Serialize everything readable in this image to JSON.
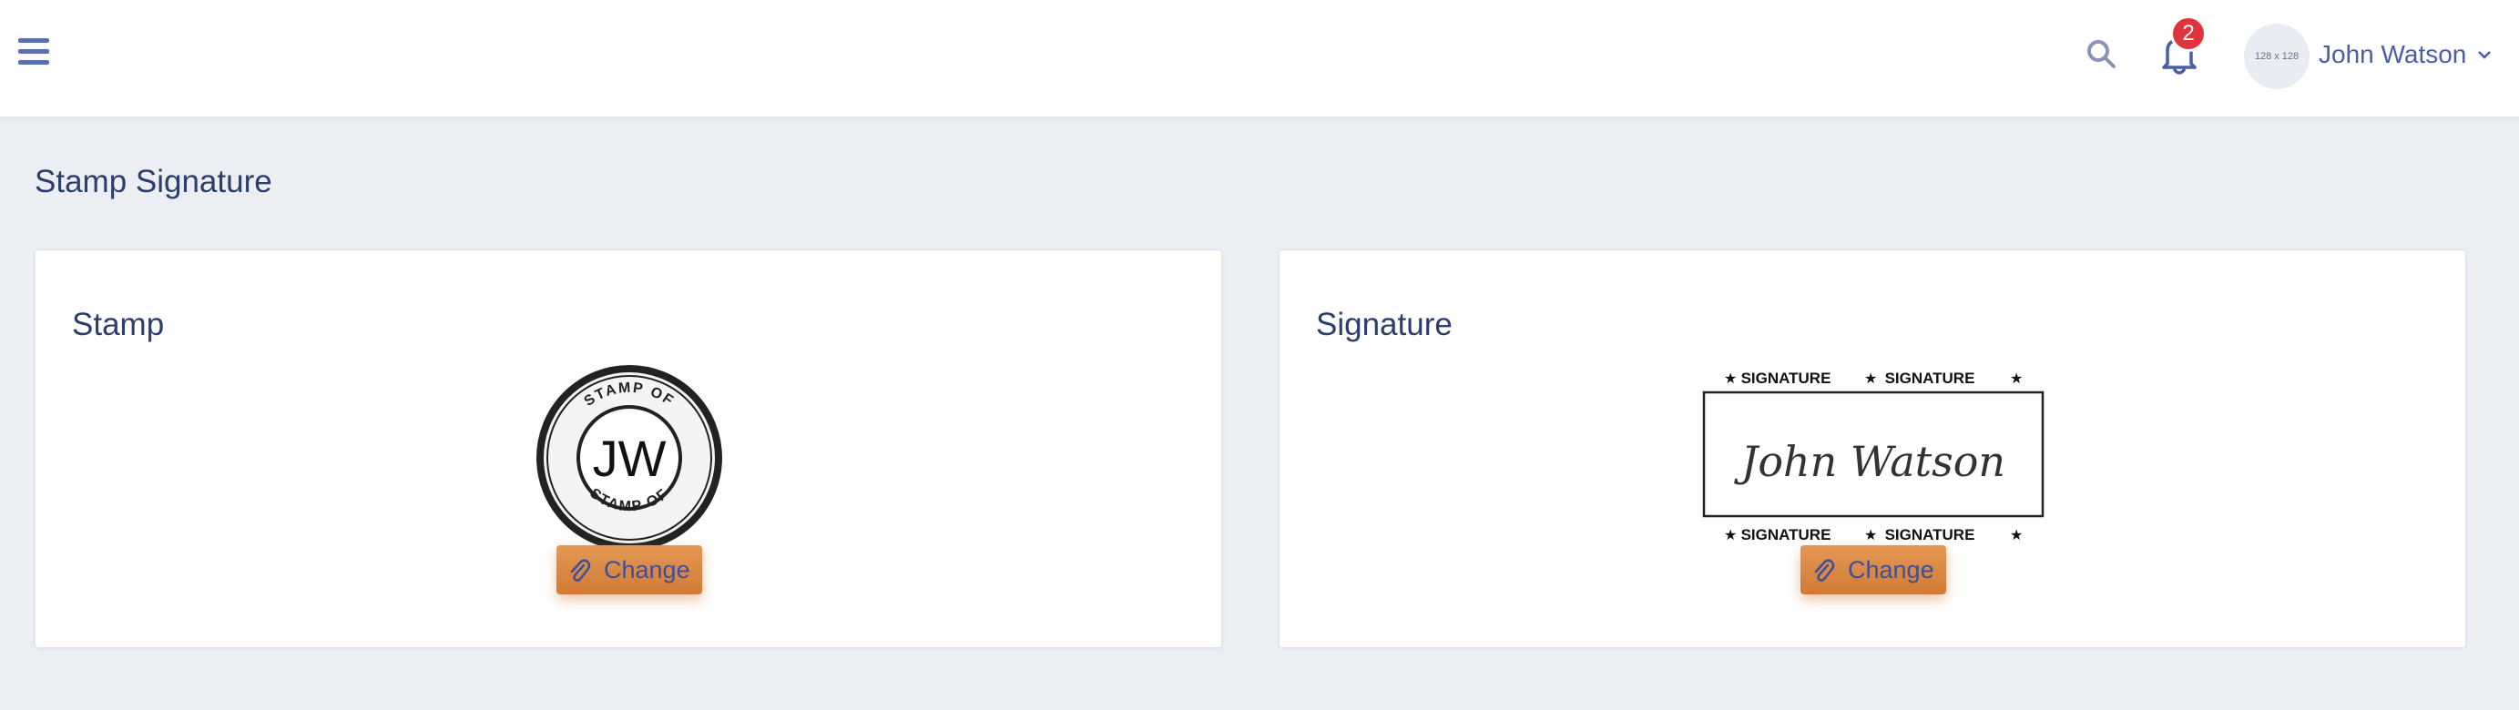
{
  "header": {
    "notifications_count": "2",
    "avatar_placeholder": "128 x 128",
    "user_name": "John Watson"
  },
  "page": {
    "title": "Stamp Signature"
  },
  "stamp_card": {
    "title": "Stamp",
    "stamp_initials": "JW",
    "stamp_ring_text": "STAMP OF",
    "change_label": "Change"
  },
  "signature_card": {
    "title": "Signature",
    "banner_text": "SIGNATURE",
    "signature_text": "John Watson",
    "change_label": "Change"
  },
  "colors": {
    "accent": "#d07a35",
    "badge": "#e0343c",
    "text": "#2c3e6a",
    "link": "#4a5ea8",
    "background": "#ebeef3"
  }
}
